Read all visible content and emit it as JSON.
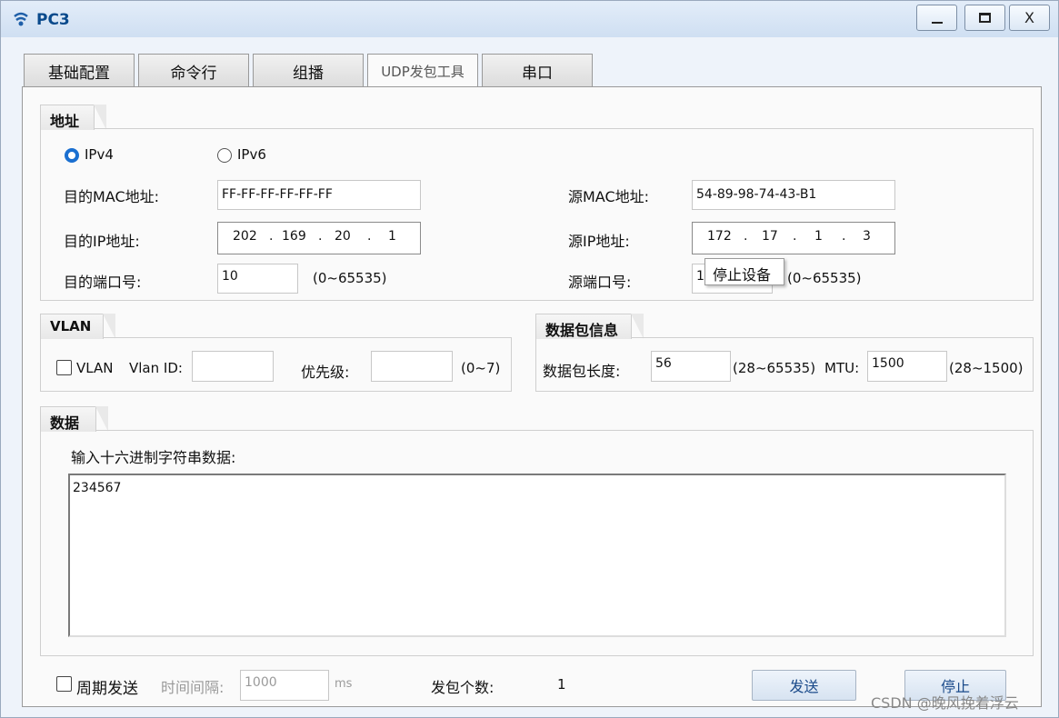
{
  "window": {
    "title": "PC3",
    "minimize_icon": "minimize-icon",
    "maximize_icon": "maximize-icon",
    "close_label": "X"
  },
  "tabs": [
    {
      "label": "基础配置",
      "active": false
    },
    {
      "label": "命令行",
      "active": false
    },
    {
      "label": "组播",
      "active": false
    },
    {
      "label": "UDP发包工具",
      "active": true
    },
    {
      "label": "串口",
      "active": false
    }
  ],
  "address": {
    "group_title": "地址",
    "ipv4_label": "IPv4",
    "ipv6_label": "IPv6",
    "ipv4_selected": true,
    "dst_mac_label": "目的MAC地址:",
    "dst_mac_value": "FF-FF-FF-FF-FF-FF",
    "src_mac_label": "源MAC地址:",
    "src_mac_value": "54-89-98-74-43-B1",
    "dst_ip_label": "目的IP地址:",
    "dst_ip": [
      "202",
      "169",
      "20",
      "1"
    ],
    "src_ip_label": "源IP地址:",
    "src_ip": [
      "172",
      "17",
      "1",
      "3"
    ],
    "dst_port_label": "目的端口号:",
    "dst_port_value": "10",
    "dst_port_range": "(0~65535)",
    "src_port_label": "源端口号:",
    "src_port_value": "1",
    "src_port_range": "(0~65535)",
    "ip_dot": "."
  },
  "tooltip": "停止设备",
  "vlan": {
    "group_title": "VLAN",
    "checkbox_label": "VLAN",
    "vlan_id_label": "Vlan ID:",
    "priority_label": "优先级:",
    "priority_range": "(0~7)"
  },
  "packet": {
    "group_title": "数据包信息",
    "length_label": "数据包长度:",
    "length_value": "56",
    "length_range": "(28~65535)",
    "mtu_label": "MTU:",
    "mtu_value": "1500",
    "mtu_range": "(28~1500)"
  },
  "data": {
    "group_title": "数据",
    "prompt": "输入十六进制字符串数据:",
    "value": "234567"
  },
  "footer": {
    "periodic_label": "周期发送",
    "interval_label": "时间间隔:",
    "interval_value": "1000",
    "interval_unit": "ms",
    "count_label": "发包个数:",
    "count_value": "1",
    "send_button": "发送",
    "stop_button": "停止"
  },
  "watermark": "CSDN @晚风挽着浮云"
}
